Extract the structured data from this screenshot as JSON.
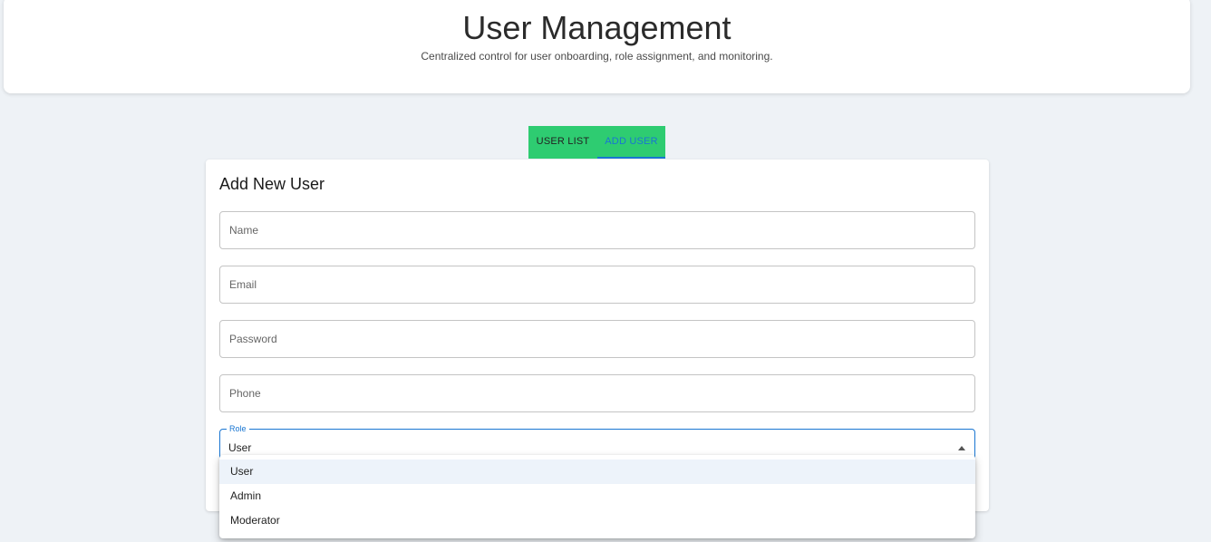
{
  "header": {
    "title": "User Management",
    "subtitle": "Centralized control for user onboarding, role assignment, and monitoring."
  },
  "tabs": [
    {
      "label": "USER LIST",
      "active": false
    },
    {
      "label": "ADD USER",
      "active": true
    }
  ],
  "form": {
    "title": "Add New User",
    "fields": {
      "name": {
        "placeholder": "Name",
        "value": ""
      },
      "email": {
        "placeholder": "Email",
        "value": ""
      },
      "password": {
        "placeholder": "Password",
        "value": ""
      },
      "phone": {
        "placeholder": "Phone",
        "value": ""
      }
    },
    "role": {
      "label": "Role",
      "value": "User",
      "options": [
        "User",
        "Admin",
        "Moderator"
      ]
    }
  },
  "colors": {
    "tab_bar": "#2ecc71",
    "accent": "#1976d2",
    "background": "#eef2f6"
  }
}
